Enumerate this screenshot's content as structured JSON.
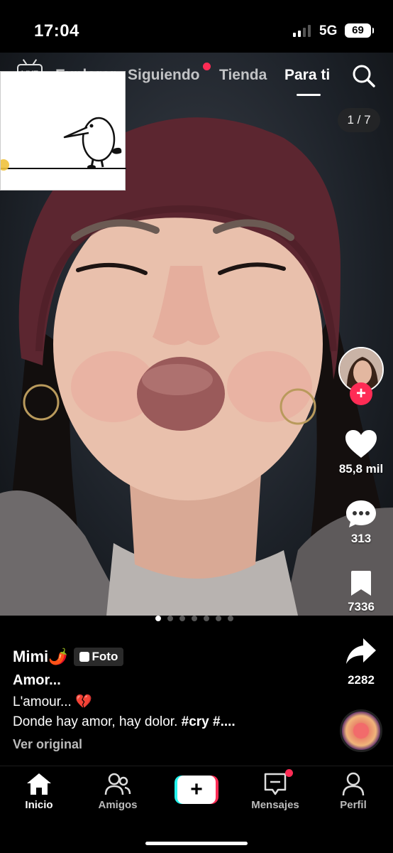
{
  "status_bar": {
    "time": "17:04",
    "network": "5G",
    "battery": "69"
  },
  "top_nav": {
    "live_label": "LIVE",
    "tabs": [
      {
        "label": "Explorar",
        "active": false
      },
      {
        "label": "Siguiendo",
        "active": false,
        "has_dot": true
      },
      {
        "label": "Tienda",
        "active": false
      },
      {
        "label": "Para ti",
        "active": true
      }
    ]
  },
  "photo_counter": "1 / 7",
  "post": {
    "author": "Mimi🌶️",
    "type_badge": "Foto",
    "title": "Amor...",
    "lines": [
      "L'amour... 💔"
    ],
    "hashtag_line": {
      "text": "Donde hay amor, hay dolor. ",
      "tags": "#cry #...."
    },
    "translate_link": "Ver original",
    "photo_index": 1,
    "photo_total": 7
  },
  "actions": {
    "likes": "85,8 mil",
    "comments": "313",
    "saves": "7336",
    "shares": "2282"
  },
  "bottom_nav": {
    "items": [
      {
        "label": "Inicio",
        "icon": "home-icon",
        "active": true
      },
      {
        "label": "Amigos",
        "icon": "friends-icon",
        "active": false
      },
      {
        "label": "Mensajes",
        "icon": "inbox-icon",
        "active": false,
        "has_dot": true
      },
      {
        "label": "Perfil",
        "icon": "profile-icon",
        "active": false
      }
    ],
    "create_label": "+"
  },
  "colors": {
    "accent": "#fe2c55",
    "cyan": "#25f4ee",
    "background": "#000000"
  }
}
